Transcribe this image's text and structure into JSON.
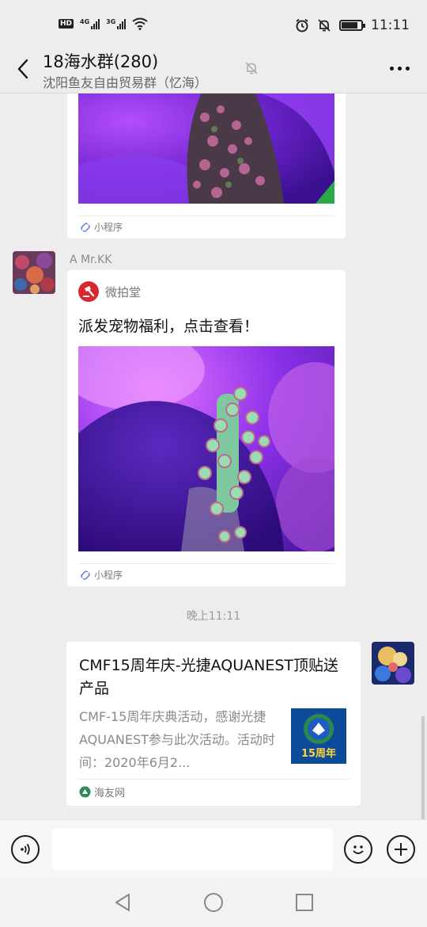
{
  "status_bar": {
    "network_a": "4G",
    "network_b": "3G",
    "time": "11:11"
  },
  "header": {
    "title": "18海水群(280)",
    "subtitle": "沈阳鱼友自由贸易群（忆海）",
    "icons": [
      "back-icon",
      "mute-icon",
      "more-icon"
    ]
  },
  "messages": [
    {
      "type": "mini_program",
      "tag": "小程序"
    },
    {
      "type": "mini_program",
      "sender": "A  Mr.KK",
      "app_name": "微拍堂",
      "title": "派发宠物福利，点击查看！",
      "tag": "小程序"
    },
    {
      "type": "timestamp",
      "text": "晚上11:11"
    },
    {
      "type": "article_link",
      "title": "CMF15周年庆-光捷AQUANEST顶贴送产品",
      "desc": "CMF-15周年庆典活动，感谢光捷AQUANEST参与此次活动。活动时间：2020年6月2...",
      "thumb_text": "15周年",
      "source": "海友网"
    }
  ],
  "input_bar": {
    "placeholder": "",
    "icons": [
      "voice-icon",
      "emoji-icon",
      "plus-icon"
    ]
  },
  "nav_bar": {
    "icons": [
      "nav-back-icon",
      "nav-home-icon",
      "nav-recent-icon"
    ]
  },
  "colors": {
    "background": "#ededed",
    "card": "#ffffff",
    "weipaitang_red": "#d6282e",
    "coral_purple": "#5a1eb0"
  }
}
